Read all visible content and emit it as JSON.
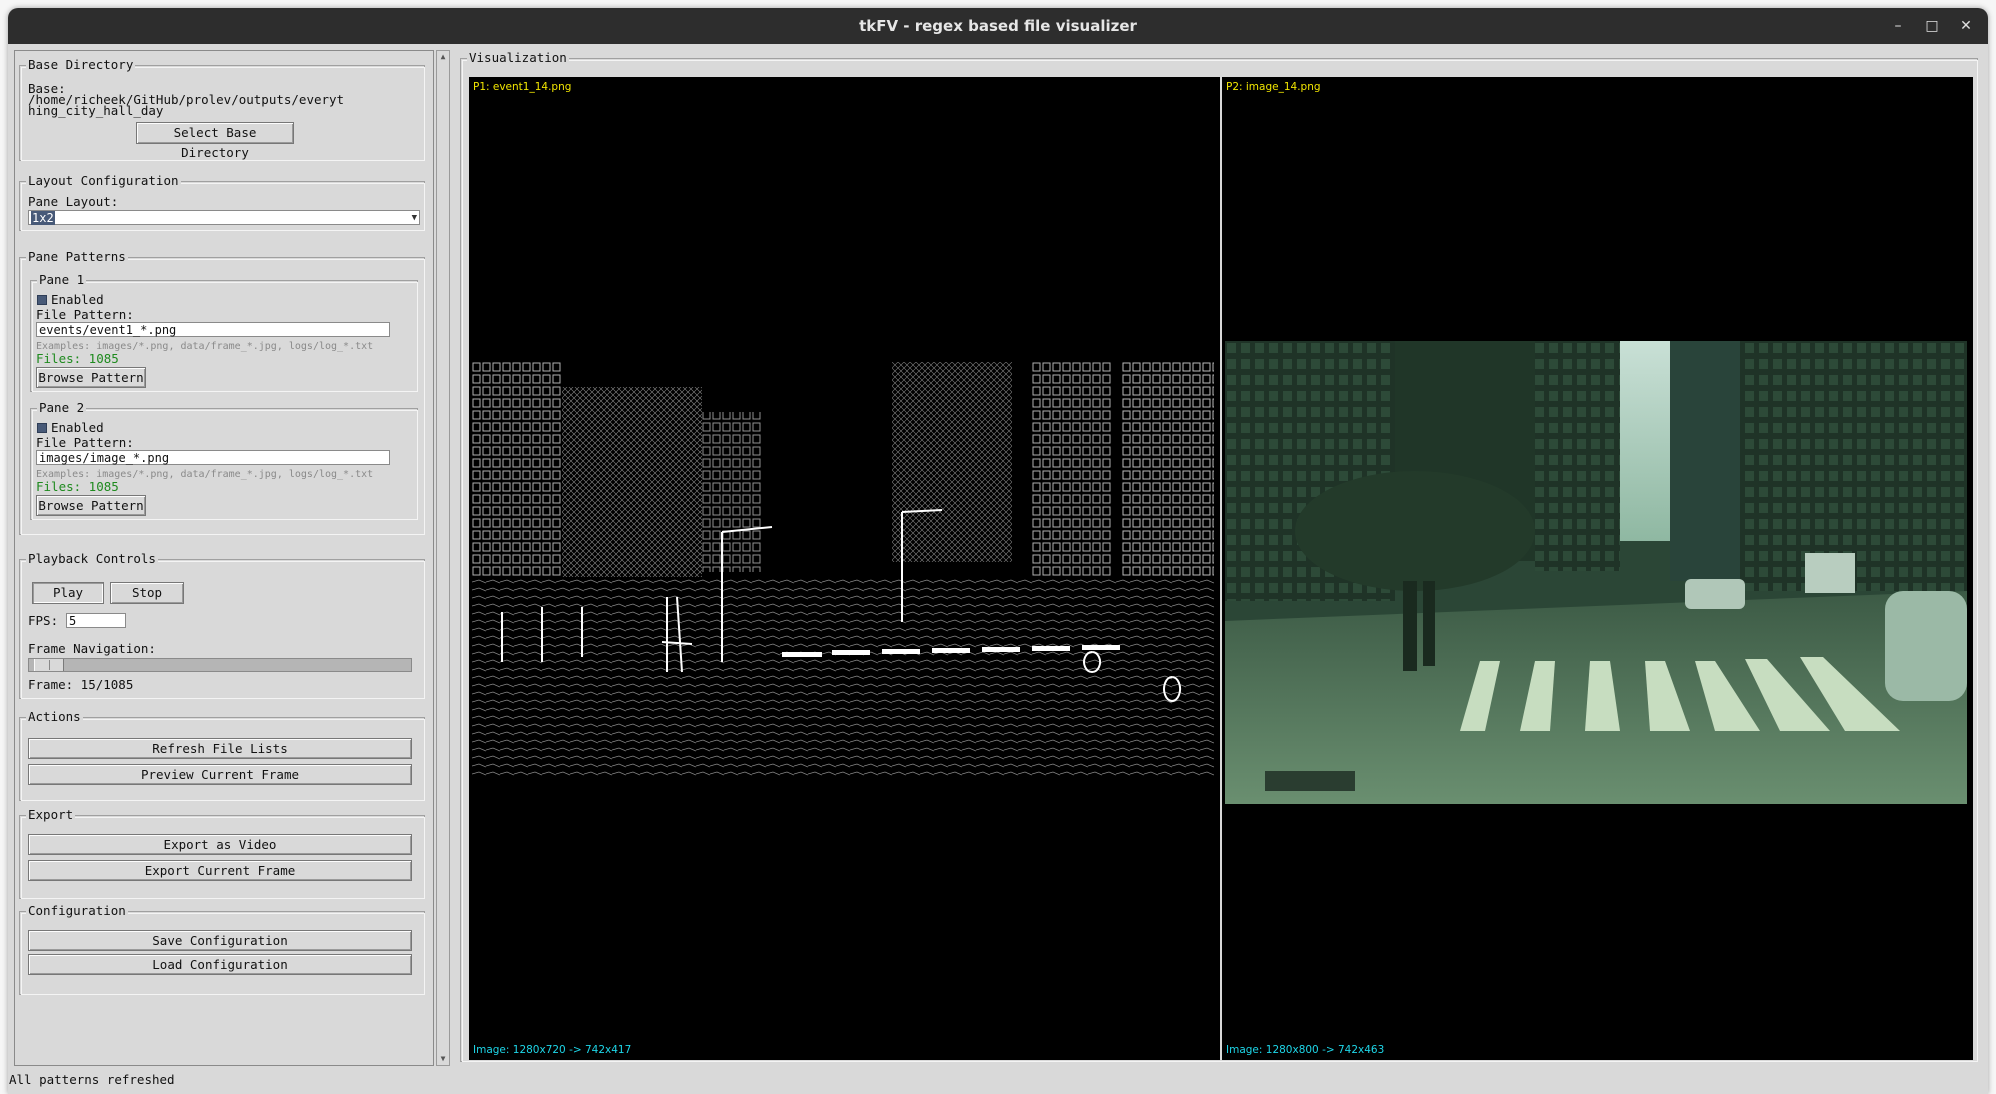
{
  "window": {
    "title": "tkFV - regex based file visualizer",
    "minimize": "–",
    "maximize": "□",
    "close": "✕"
  },
  "base_directory": {
    "legend": "Base Directory",
    "label": "Base:",
    "path_line1": "/home/richeek/GitHub/prolev/outputs/everyt",
    "path_line2": "hing_city_hall_day",
    "select_button": "Select Base Directory"
  },
  "layout_config": {
    "legend": "Layout Configuration",
    "label": "Pane Layout:",
    "selected": "1x2"
  },
  "pane_patterns": {
    "legend": "Pane Patterns",
    "panes": [
      {
        "legend": "Pane 1",
        "enabled_label": "Enabled",
        "enabled": true,
        "pattern_label": "File Pattern:",
        "pattern": "events/event1_*.png",
        "examples": "Examples: images/*.png, data/frame_*.jpg, logs/log_*.txt",
        "files": "Files: 1085",
        "browse": "Browse Pattern"
      },
      {
        "legend": "Pane 2",
        "enabled_label": "Enabled",
        "enabled": true,
        "pattern_label": "File Pattern:",
        "pattern": "images/image_*.png",
        "examples": "Examples: images/*.png, data/frame_*.jpg, logs/log_*.txt",
        "files": "Files: 1085",
        "browse": "Browse Pattern"
      }
    ]
  },
  "playback": {
    "legend": "Playback Controls",
    "play": "Play",
    "stop": "Stop",
    "fps_label": "FPS:",
    "fps_value": "5",
    "nav_label": "Frame Navigation:",
    "frame_text": "Frame: 15/1085",
    "frame_current": 15,
    "frame_total": 1085
  },
  "actions": {
    "legend": "Actions",
    "refresh": "Refresh File Lists",
    "preview": "Preview Current Frame"
  },
  "export": {
    "legend": "Export",
    "video": "Export as Video",
    "frame": "Export Current Frame"
  },
  "configuration": {
    "legend": "Configuration",
    "save": "Save Configuration",
    "load": "Load Configuration"
  },
  "visualization": {
    "legend": "Visualization",
    "panes": [
      {
        "label": "P1: event1_14.png",
        "info": "Image: 1280x720 -> 742x417"
      },
      {
        "label": "P2: image_14.png",
        "info": "Image: 1280x800 -> 742x463"
      }
    ]
  },
  "status": "All patterns refreshed",
  "colors": {
    "pane_label": "#f2e600",
    "pane_info": "#1ed6e8",
    "files_count": "#1e8a1e",
    "checkbox": "#485a78"
  }
}
